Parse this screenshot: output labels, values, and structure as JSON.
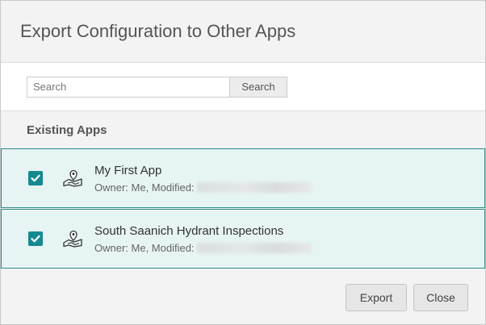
{
  "dialog": {
    "title": "Export Configuration to Other Apps"
  },
  "search": {
    "placeholder": "Search",
    "value": "",
    "button_label": "Search"
  },
  "section": {
    "label": "Existing Apps"
  },
  "apps": [
    {
      "name": "My First App",
      "owner_label": "Owner: Me, Modified:",
      "checked": true,
      "icon": "map-pin-icon"
    },
    {
      "name": "South Saanich Hydrant Inspections",
      "owner_label": "Owner: Me, Modified:",
      "checked": true,
      "icon": "map-pin-icon"
    }
  ],
  "footer": {
    "export_label": "Export",
    "close_label": "Close"
  },
  "colors": {
    "accent": "#158a90",
    "row_background": "#e6f4f3",
    "row_border": "#2d8a8a"
  }
}
